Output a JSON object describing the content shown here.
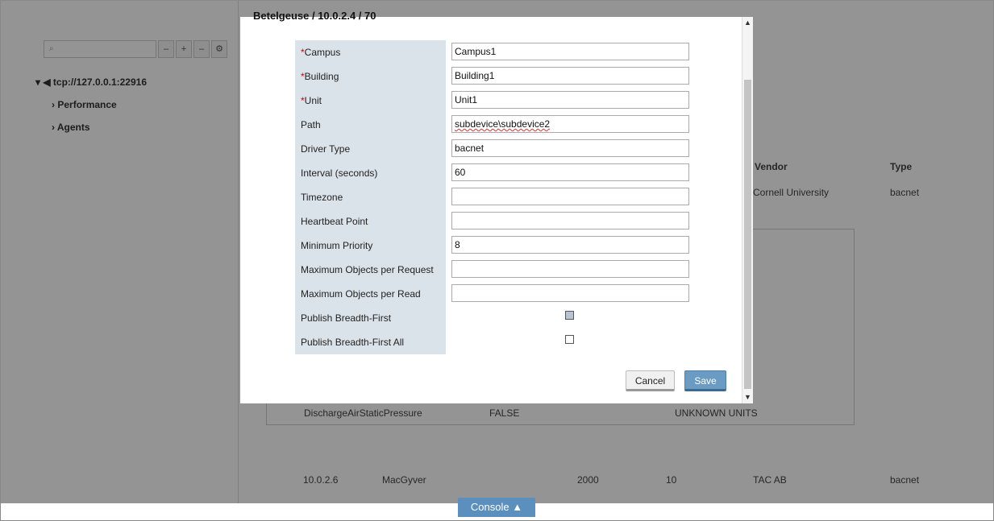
{
  "background": {
    "tree": [
      "tcp://127.0.0.1:22916",
      "Performance",
      "Agents"
    ],
    "columns": [
      "Vendor",
      "Type"
    ],
    "rows": [
      {
        "vendor": "Cornell University",
        "type": "bacnet"
      },
      {
        "address": "10.0.2.6",
        "name": "MacGyver",
        "num": "2000",
        "count": "10",
        "vendor": "TAC AB",
        "type": "bacnet"
      }
    ],
    "point_row": {
      "name": "DischargeAirStaticPressure",
      "value": "FALSE",
      "units": "UNKNOWN UNITS"
    }
  },
  "modal": {
    "title": "Betelgeuse / 10.0.2.4 / 70",
    "fields": [
      {
        "label": "Campus",
        "required": "*",
        "value": "Campus1"
      },
      {
        "label": "Building",
        "required": "*",
        "value": "Building1"
      },
      {
        "label": "Unit",
        "required": "*",
        "value": "Unit1"
      },
      {
        "label": "Path",
        "required": "",
        "value": "subdevice\\subdevice2"
      },
      {
        "label": "Driver Type",
        "required": "",
        "value": "bacnet"
      },
      {
        "label": "Interval (seconds)",
        "required": "",
        "value": "60"
      },
      {
        "label": "Timezone",
        "required": "",
        "value": ""
      },
      {
        "label": "Heartbeat Point",
        "required": "",
        "value": ""
      },
      {
        "label": "Minimum Priority",
        "required": "",
        "value": "8"
      },
      {
        "label": "Maximum Objects per Request",
        "required": "",
        "value": ""
      },
      {
        "label": "Maximum Objects per Read",
        "required": "",
        "value": ""
      }
    ],
    "checkboxes": [
      {
        "label": "Publish Breadth-First",
        "checked": true
      },
      {
        "label": "Publish Breadth-First All",
        "checked": false
      }
    ],
    "cancel_label": "Cancel",
    "save_label": "Save"
  },
  "console_label": "Console ▲"
}
